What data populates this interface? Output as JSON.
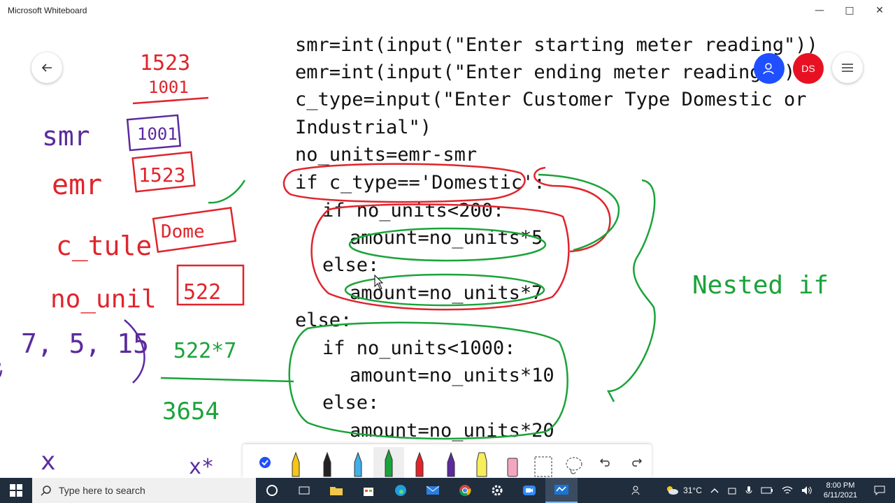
{
  "window": {
    "title": "Microsoft Whiteboard",
    "minimize": "—",
    "maximize": "□",
    "close": "✕"
  },
  "header": {
    "avatar_initials": "DS"
  },
  "code_lines": [
    "smr=int(input(\"Enter starting meter reading\"))",
    "emr=int(input(\"Enter ending meter reading\"))",
    "c_type=input(\"Enter Customer Type Domestic or",
    "Industrial\")",
    "no_units=emr-smr",
    "if c_type=='Domestic':",
    "if no_units<200:",
    "amount=no_units*5",
    "else:",
    "amount=no_units*7",
    "else:",
    "if no_units<1000:",
    "amount=no_units*10",
    "else:",
    "amount=no_units*20"
  ],
  "notes": {
    "top_a": "1523",
    "top_b": "1001",
    "smr_label": "smr",
    "smr_value": "1001",
    "emr_label": "emr",
    "emr_value": "1523",
    "ctype_label": "c_tule",
    "ctype_value": "Dome",
    "units_label": "no_unil",
    "units_value": "522",
    "rates": "7, 5, 15",
    "calc": "522*7",
    "result": "3654",
    "nested": "Nested if",
    "bottom_left": "x",
    "bottom_mid": "x*"
  },
  "toolbar": {
    "tools": [
      "select-check",
      "pen-yellow",
      "pen-black",
      "pen-blue",
      "pen-green",
      "pen-red",
      "pen-purple",
      "highlighter-yellow",
      "eraser",
      "ruler",
      "lasso",
      "undo",
      "redo"
    ]
  },
  "taskbar": {
    "search_placeholder": "Type here to search",
    "weather": "31°C",
    "time": "8:00 PM",
    "date": "6/11/2021"
  },
  "colors": {
    "ink_red": "#e0242c",
    "ink_green": "#1aa33a",
    "ink_purple": "#5b2a9e",
    "code_ink": "#111111",
    "accent_blue": "#1f4fff",
    "avatar_red": "#e81123",
    "taskbar": "#1f2d3d"
  }
}
